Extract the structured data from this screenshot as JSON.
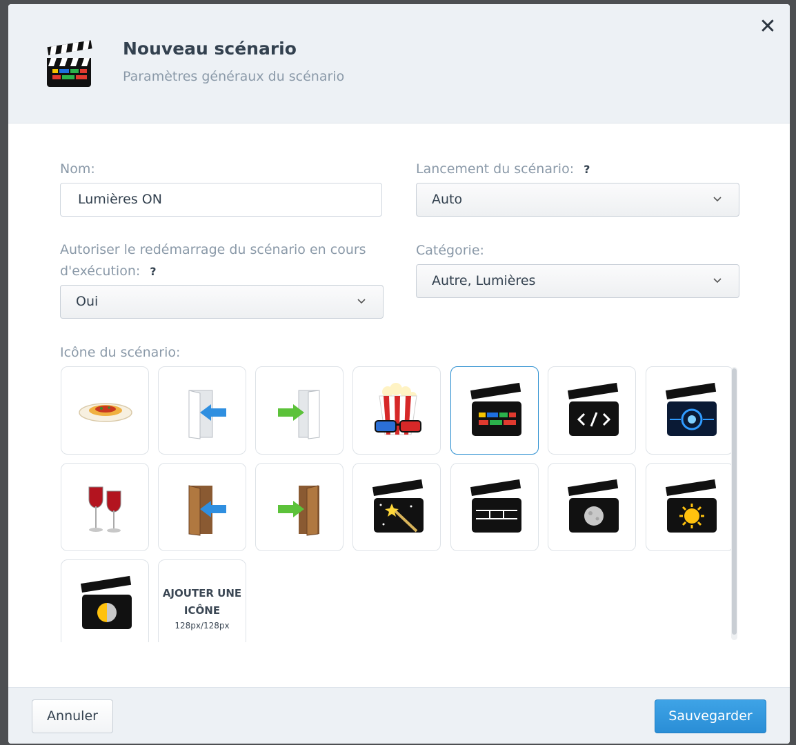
{
  "header": {
    "title": "Nouveau scénario",
    "subtitle": "Paramètres généraux du scénario"
  },
  "form": {
    "name_label": "Nom:",
    "name_value": "Lumières ON",
    "launch_label": "Lancement du scénario:",
    "launch_value": "Auto",
    "restart_label_line1": "Autoriser le redémarrage du scénario en cours",
    "restart_label_line2": "d'exécution:",
    "restart_value": "Oui",
    "category_label": "Catégorie:",
    "category_value": "Autre, Lumières",
    "help_mark": "?"
  },
  "icons": {
    "label": "Icône du scénario:",
    "items": [
      {
        "name": "pasta-plate-icon",
        "selected": false
      },
      {
        "name": "door-enter-blue-icon",
        "selected": false
      },
      {
        "name": "door-exit-green-icon",
        "selected": false
      },
      {
        "name": "popcorn-3d-glasses-icon",
        "selected": false
      },
      {
        "name": "clapperboard-colorful-icon",
        "selected": true
      },
      {
        "name": "clapperboard-code-icon",
        "selected": false
      },
      {
        "name": "clapperboard-tech-eye-icon",
        "selected": false
      },
      {
        "name": "wine-glasses-icon",
        "selected": false
      },
      {
        "name": "wooden-door-enter-icon",
        "selected": false
      },
      {
        "name": "wooden-door-exit-icon",
        "selected": false
      },
      {
        "name": "clapperboard-magic-wand-icon",
        "selected": false
      },
      {
        "name": "clapperboard-lines-icon",
        "selected": false
      },
      {
        "name": "clapperboard-moon-icon",
        "selected": false
      },
      {
        "name": "clapperboard-sun-icon",
        "selected": false
      },
      {
        "name": "clapperboard-sun-moon-icon",
        "selected": false
      }
    ],
    "add_title_line1": "AJOUTER UNE",
    "add_title_line2": "ICÔNE",
    "add_size": "128px/128px"
  },
  "footer": {
    "cancel_label": "Annuler",
    "save_label": "Sauvegarder"
  },
  "colors": {
    "accent": "#2c8fd0",
    "save_button": "#3399dd",
    "header_bg": "#edf1f5"
  }
}
